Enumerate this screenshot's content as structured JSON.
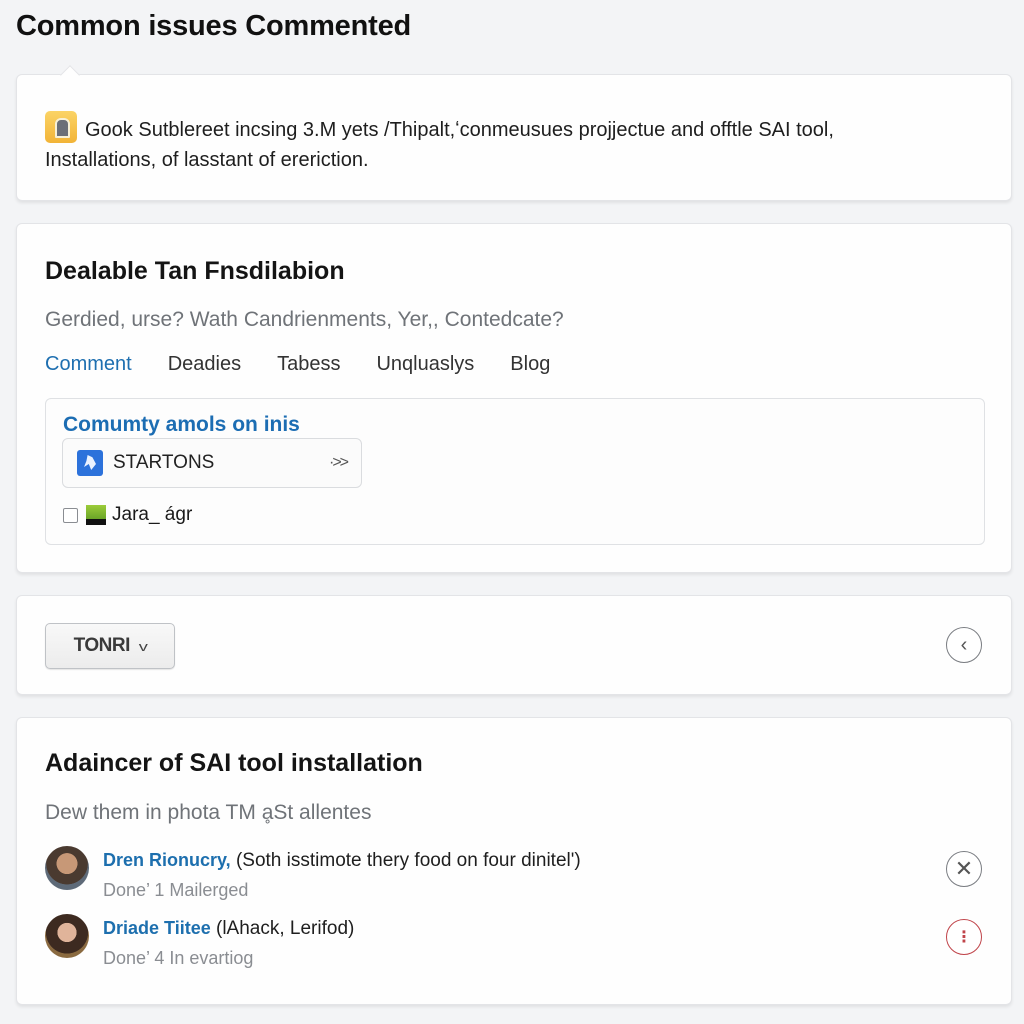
{
  "page": {
    "title": "Common issues Commented"
  },
  "intro": {
    "icon": "door-icon",
    "text_line1": "Gook Sutblereet incsing 3.M yets /Thipalt,ʻconmeusues projjectue and offtle SAI tool,",
    "text_line2": "Installations, of lasstant of ereriction."
  },
  "feature": {
    "title": "Dealable Tan Fnsdilabion",
    "subtitle": "Gerdied, urse? Wath Candrienments, Yer,, Contedcate?",
    "tabs": [
      {
        "label": "Comment",
        "active": true
      },
      {
        "label": "Deadies",
        "active": false
      },
      {
        "label": "Tabess",
        "active": false
      },
      {
        "label": "Unqluaslys",
        "active": false
      },
      {
        "label": "Blog",
        "active": false
      }
    ],
    "community": {
      "title": "Comumty amols on inis",
      "start_item": {
        "label": "STARTONS",
        "icon": "app-icon",
        "arrow": "·>>"
      },
      "checkbox_item": {
        "label": "Jara_ áɡr",
        "checked": false,
        "icon": "green-image-icon"
      }
    }
  },
  "toolbar": {
    "dropdown_label": "TONRI",
    "dropdown_chevron": "v",
    "back_icon": "‹"
  },
  "comments_section": {
    "title": "Adaincer of SAI tool installation",
    "subtitle": "Dew them in phota TM ḁSt allentes",
    "comments": [
      {
        "name": "Dren Rionucry,",
        "text": " (Soth isstimote thery food on four dinitel')",
        "meta": "Done’ 1 Mailerged",
        "action_icon": "✕"
      },
      {
        "name": "Driade Tiitee",
        "text": "  (lAhack, Lerifod)",
        "meta": "Done’ 4 In evartiog",
        "action_icon": "⋮"
      }
    ]
  },
  "colors": {
    "accent_blue": "#1e6fb0",
    "danger_red": "#c0444a",
    "background": "#f3f4f6"
  }
}
